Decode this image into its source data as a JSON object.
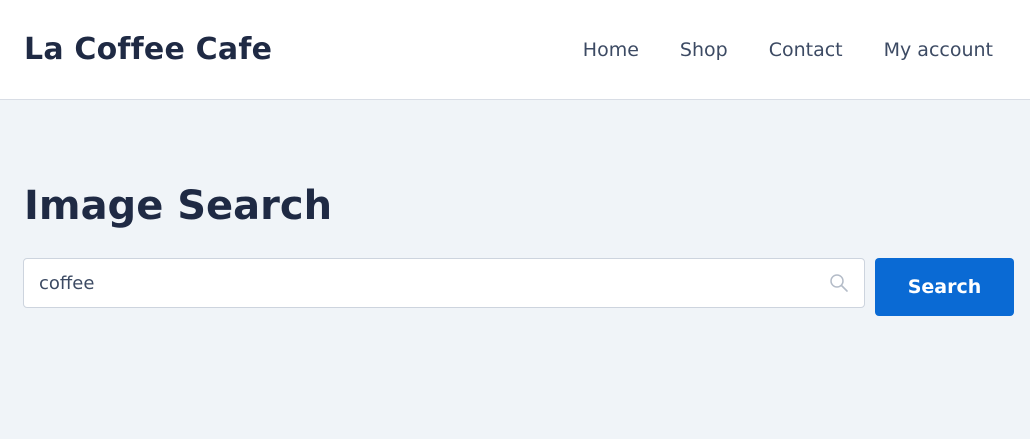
{
  "header": {
    "brand": "La Coffee Cafe",
    "nav": [
      {
        "label": "Home"
      },
      {
        "label": "Shop"
      },
      {
        "label": "Contact"
      },
      {
        "label": "My account"
      }
    ]
  },
  "main": {
    "title": "Image Search",
    "search": {
      "value": "coffee",
      "icon": "search-icon",
      "button_label": "Search"
    }
  },
  "colors": {
    "background": "#f0f4f8",
    "header_bg": "#ffffff",
    "text": "#1f2a44",
    "accent": "#0a6ad4"
  }
}
